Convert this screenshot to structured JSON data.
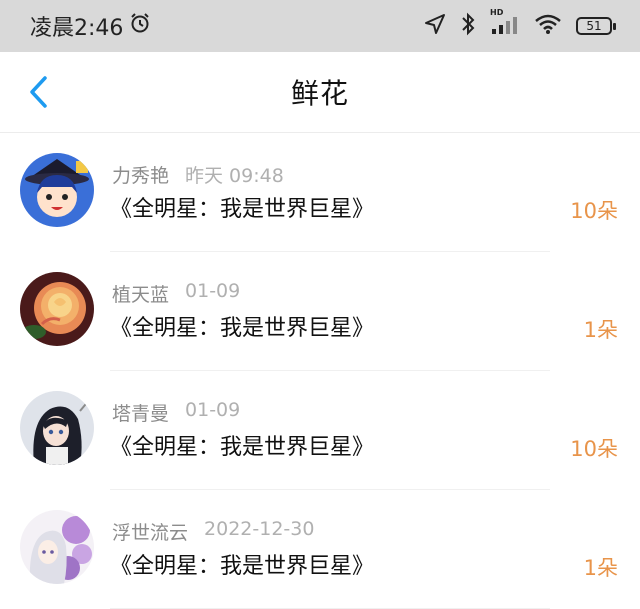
{
  "status_bar": {
    "time": "凌晨2:46",
    "battery": "51",
    "network_badge": "HD"
  },
  "nav": {
    "title": "鲜花"
  },
  "items": [
    {
      "user": "力秀艳",
      "date": "昨天 09:48",
      "book": "《全明星：我是世界巨星》",
      "count": "10朵",
      "avatar_icon": "anime-girl-hat-avatar"
    },
    {
      "user": "植天蓝",
      "date": "01-09",
      "book": "《全明星：我是世界巨星》",
      "count": "1朵",
      "avatar_icon": "rose-flower-avatar"
    },
    {
      "user": "塔青曼",
      "date": "01-09",
      "book": "《全明星：我是世界巨星》",
      "count": "10朵",
      "avatar_icon": "anime-dark-hair-avatar"
    },
    {
      "user": "浮世流云",
      "date": "2022-12-30",
      "book": "《全明星：我是世界巨星》",
      "count": "1朵",
      "avatar_icon": "anime-white-hair-avatar"
    }
  ],
  "colors": {
    "accent": "#e8944a",
    "back_arrow": "#1e9bf0",
    "status_bar_bg": "#d9d9d9"
  }
}
